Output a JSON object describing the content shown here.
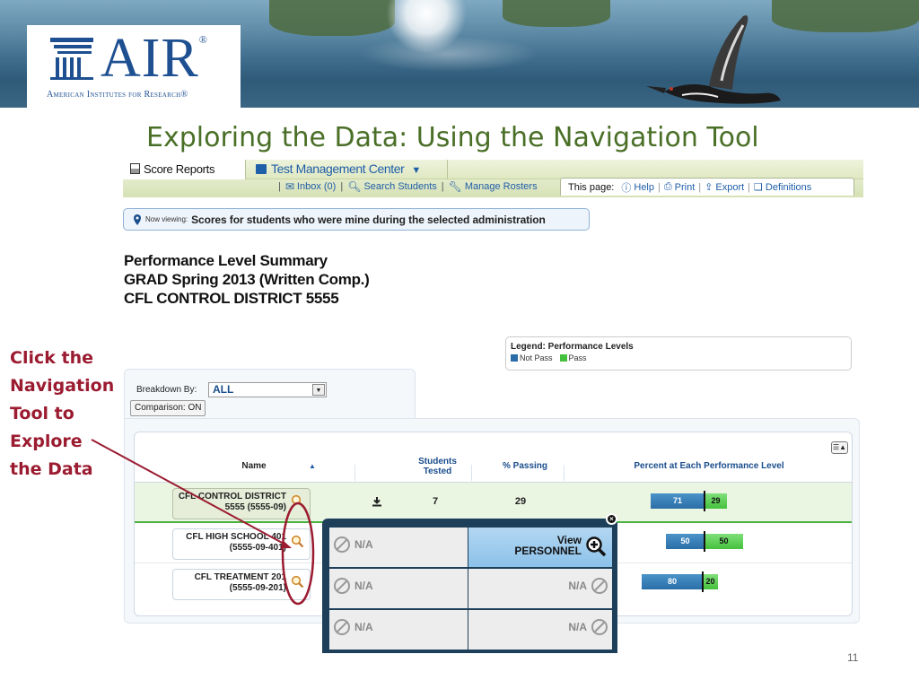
{
  "banner": {
    "logo_text": "AIR",
    "logo_registered": "®",
    "logo_subtitle": "American Institutes for Research®"
  },
  "slide": {
    "title": "Exploring the Data: Using the Navigation Tool",
    "page_number": "11",
    "annotation_lines": [
      "Click the",
      "Navigation",
      "Tool to",
      "Explore",
      "the Data"
    ],
    "annotation_color": "#9b1b30",
    "title_color": "#4a6f27"
  },
  "topbar": {
    "tab_score": "Score Reports",
    "tab_tmc": "Test Management Center",
    "links": [
      {
        "icon": "inbox-icon",
        "label": "Inbox (0)"
      },
      {
        "icon": "search-icon",
        "label": "Search Students"
      },
      {
        "icon": "wrench-icon",
        "label": "Manage Rosters"
      }
    ],
    "this_page_label": "This page:",
    "page_links": [
      {
        "icon": "help-icon",
        "label": "Help"
      },
      {
        "icon": "print-icon",
        "label": "Print"
      },
      {
        "icon": "export-icon",
        "label": "Export"
      },
      {
        "icon": "book-icon",
        "label": "Definitions"
      }
    ]
  },
  "now_viewing": {
    "prefix": "Now viewing:",
    "text": "Scores for students who were mine during the selected administration"
  },
  "report": {
    "title": "Performance Level Summary",
    "test": "GRAD Spring 2013 (Written Comp.)",
    "district": "CFL CONTROL DISTRICT 5555"
  },
  "legend": {
    "title": "Legend: Performance Levels",
    "items": [
      {
        "label": "Not Pass",
        "color": "#2b6ea7"
      },
      {
        "label": "Pass",
        "color": "#45c03c"
      }
    ]
  },
  "breakdown": {
    "label": "Breakdown By:",
    "value": "ALL",
    "comparison": "Comparison: ON"
  },
  "table": {
    "headers": {
      "name": "Name",
      "sort_arrow": "▲",
      "students_tested_1": "Students",
      "students_tested_2": "Tested",
      "passing": "% Passing",
      "levels": "Percent at Each Performance Level"
    },
    "rows": [
      {
        "name_1": "CFL CONTROL DISTRICT",
        "name_2": "5555 (5555-09)",
        "tested": "7",
        "passing": "29",
        "not_pass": 71,
        "pass": 29
      },
      {
        "name_1": "CFL HIGH SCHOOL 401",
        "name_2": "(5555-09-401)",
        "not_pass": 50,
        "pass": 50
      },
      {
        "name_1": "CFL TREATMENT 201",
        "name_2": "(5555-09-201)",
        "not_pass": 80,
        "pass": 20
      }
    ]
  },
  "popup": {
    "close": "×",
    "na": "N/A",
    "view_1": "View",
    "view_2": "PERSONNEL"
  }
}
